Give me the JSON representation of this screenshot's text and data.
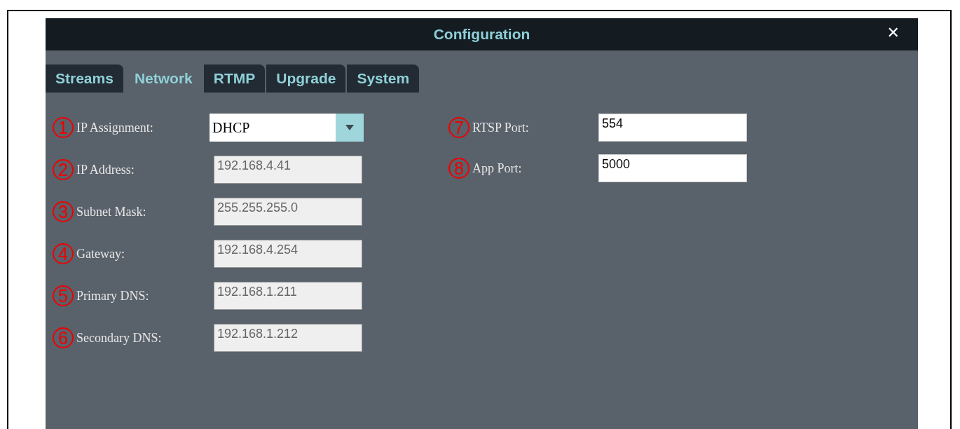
{
  "window": {
    "title": "Configuration",
    "close": "✕"
  },
  "tabs": [
    {
      "label": "Streams",
      "selected": false
    },
    {
      "label": "Network",
      "selected": true
    },
    {
      "label": "RTMP",
      "selected": false
    },
    {
      "label": "Upgrade",
      "selected": false
    },
    {
      "label": "System",
      "selected": false
    }
  ],
  "left_fields": [
    {
      "callout": "1",
      "label": "IP Assignment:",
      "kind": "dropdown",
      "value": "DHCP",
      "disabled": false
    },
    {
      "callout": "2",
      "label": "IP Address:",
      "kind": "text",
      "value": "192.168.4.41",
      "disabled": true
    },
    {
      "callout": "3",
      "label": "Subnet Mask:",
      "kind": "text",
      "value": "255.255.255.0",
      "disabled": true
    },
    {
      "callout": "4",
      "label": "Gateway:",
      "kind": "text",
      "value": "192.168.4.254",
      "disabled": true
    },
    {
      "callout": "5",
      "label": "Primary DNS:",
      "kind": "text",
      "value": "192.168.1.211",
      "disabled": true
    },
    {
      "callout": "6",
      "label": "Secondary DNS:",
      "kind": "text",
      "value": "192.168.1.212",
      "disabled": true
    }
  ],
  "right_fields": [
    {
      "callout": "7",
      "label": "RTSP Port:",
      "kind": "text",
      "value": "554",
      "disabled": false
    },
    {
      "callout": "8",
      "label": "App Port:",
      "kind": "text",
      "value": "5000",
      "disabled": false
    }
  ]
}
